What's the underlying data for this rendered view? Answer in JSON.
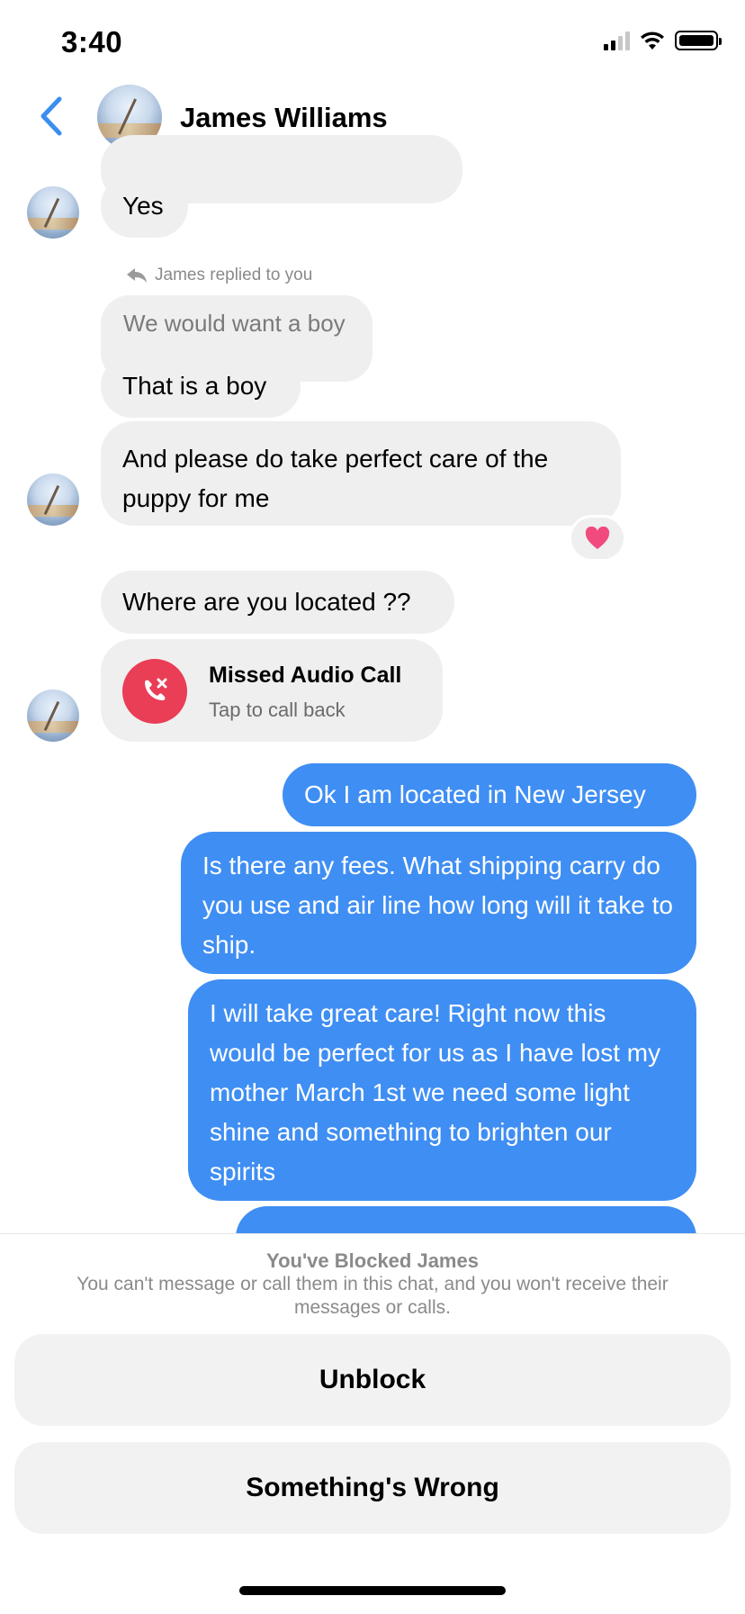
{
  "status_bar": {
    "time": "3:40",
    "icons": [
      "cellular-signal-icon",
      "wifi-icon",
      "battery-icon"
    ]
  },
  "header": {
    "back_icon": "chevron-left-icon",
    "contact_name": "James Williams"
  },
  "messages": {
    "yes": "Yes",
    "reply_label": "James replied to you",
    "reply_quote": "We would want a boy",
    "boy": "That is a boy",
    "puppy": "And please do take perfect care of the puppy for me",
    "reaction": "heart",
    "location_question": "Where are you located ??",
    "missed_call": {
      "title": "Missed Audio Call",
      "subtitle": "Tap to call back"
    },
    "sent_location": "Ok I am located in New Jersey",
    "sent_fees": "Is there any fees. What shipping carry do you use and air line how long will it take to ship.",
    "sent_care": "I will take great care! Right now this would be perfect for us as I have lost my mother March 1st we need some light shine and something to brighten our spirits"
  },
  "blocked": {
    "title": "You've Blocked James",
    "description": "You can't message or call them in this chat, and you won't receive their messages or calls.",
    "unblock_label": "Unblock",
    "wrong_label": "Something's Wrong"
  },
  "colors": {
    "sent_bubble": "#3f8ef3",
    "received_bubble": "#efefef",
    "missed_call": "#ea3d56",
    "accent": "#3b8ef0"
  }
}
